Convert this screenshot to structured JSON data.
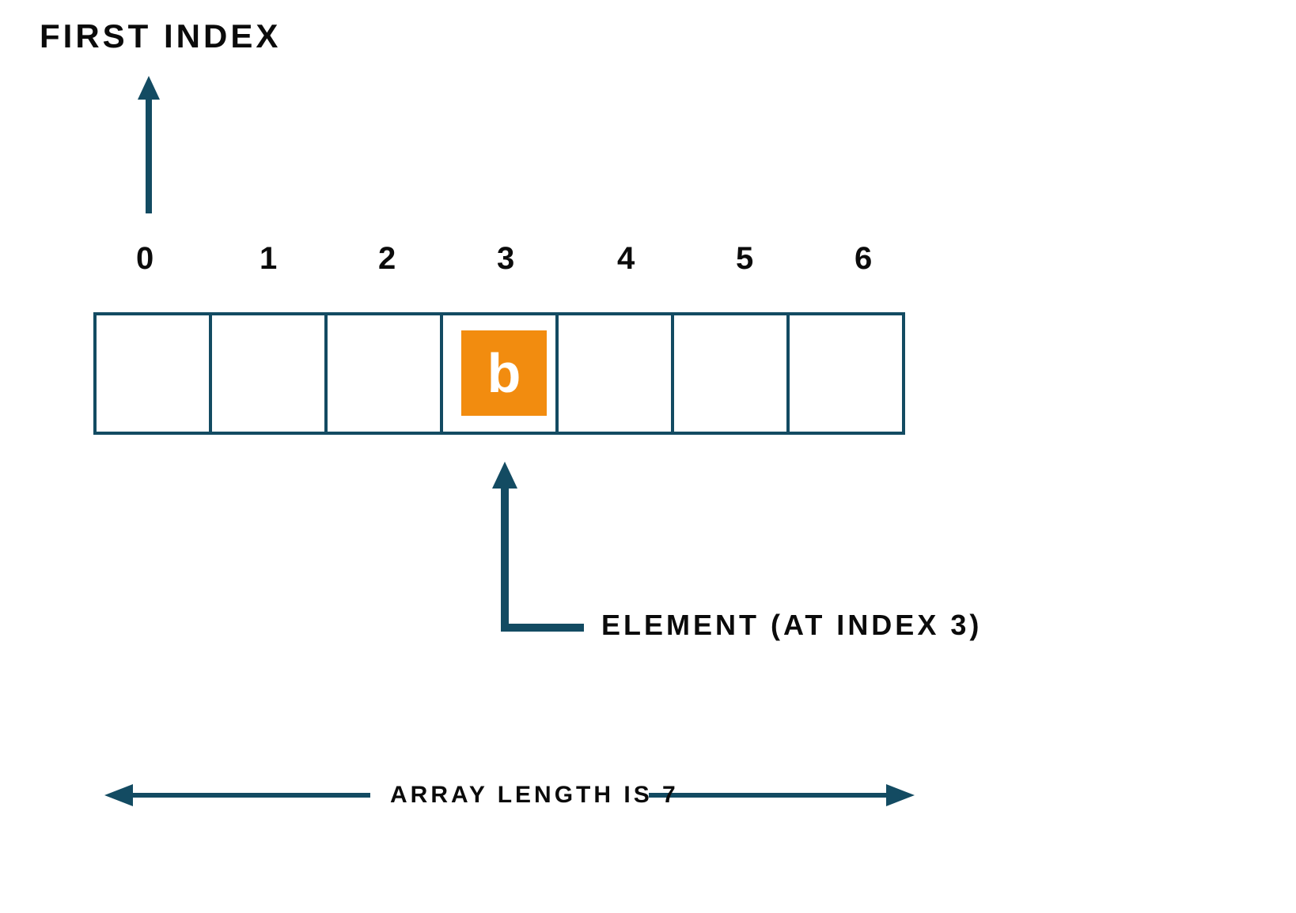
{
  "labels": {
    "first_index": "FIRST INDEX",
    "element": "ELEMENT (AT INDEX 3)",
    "length": "ARRAY LENGTH IS 7"
  },
  "indices": [
    "0",
    "1",
    "2",
    "3",
    "4",
    "5",
    "6"
  ],
  "element": {
    "value": "b",
    "index": 3
  },
  "array_length": 7,
  "colors": {
    "stroke": "#134b62",
    "accent": "#f28c0f",
    "text": "#0b0b0b"
  }
}
